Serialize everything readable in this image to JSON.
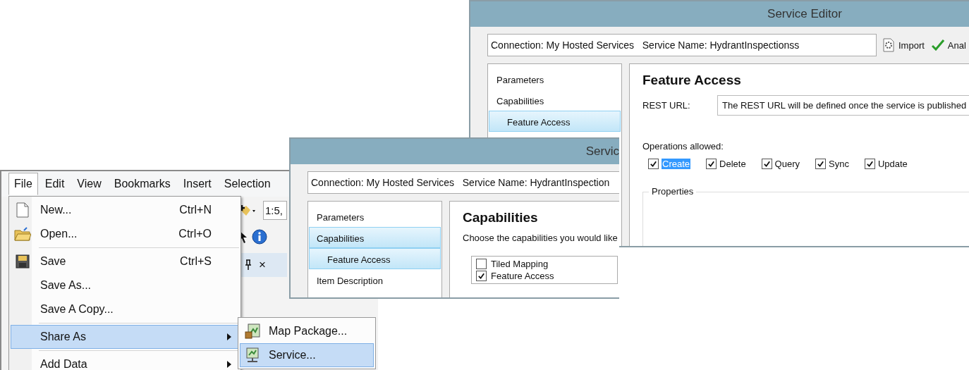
{
  "map_window": {
    "menu_bar": [
      {
        "label": "File",
        "selected": true
      },
      {
        "label": "Edit",
        "selected": false
      },
      {
        "label": "View",
        "selected": false
      },
      {
        "label": "Bookmarks",
        "selected": false
      },
      {
        "label": "Insert",
        "selected": false
      },
      {
        "label": "Selection",
        "selected": false
      }
    ],
    "toolbar": {
      "scale": "1:5,"
    },
    "panel": {
      "close": "×"
    },
    "file_menu": [
      [
        {
          "label": "New...",
          "shortcut": "Ctrl+N",
          "submenu": false,
          "selected": false
        },
        {
          "label": "Open...",
          "shortcut": "Ctrl+O",
          "submenu": false,
          "selected": false
        }
      ],
      [
        {
          "label": "Save",
          "shortcut": "Ctrl+S",
          "submenu": false,
          "selected": false
        },
        {
          "label": "Save As...",
          "submenu": false,
          "selected": false
        },
        {
          "label": "Save A Copy...",
          "submenu": false,
          "selected": false
        }
      ],
      [
        {
          "label": "Share As",
          "submenu": true,
          "selected": true
        }
      ],
      [
        {
          "label": "Add Data",
          "submenu": true,
          "selected": false
        }
      ]
    ],
    "share_submenu": [
      {
        "label": "Map Package...",
        "selected": false
      },
      {
        "label": "Service...",
        "selected": true
      }
    ]
  },
  "capabilities_window": {
    "title": "Servic",
    "info": "Connection: My Hosted Services   Service Name: HydrantInspection",
    "nav": [
      {
        "label": "Parameters",
        "selected": false
      },
      {
        "label": "Capabilities",
        "selected": true,
        "children": [
          {
            "label": "Feature Access",
            "selected": true
          }
        ]
      },
      {
        "label": "Item Description",
        "selected": false
      }
    ],
    "heading": "Capabilities",
    "prompt": "Choose the capabilities you would like",
    "capabilities": [
      {
        "label": "Tiled Mapping",
        "checked": false
      },
      {
        "label": "Feature Access",
        "checked": true
      }
    ]
  },
  "editor_window": {
    "title": "Service Editor",
    "info": "Connection: My Hosted Services   Service Name: HydrantInspectionss",
    "toolbar": [
      {
        "label": "Import"
      },
      {
        "label": "Anal"
      }
    ],
    "nav": [
      {
        "label": "Parameters",
        "selected": false
      },
      {
        "label": "Capabilities",
        "selected": false,
        "children": [
          {
            "label": "Feature Access",
            "selected": true
          }
        ]
      }
    ],
    "heading": "Feature Access",
    "rest_url": {
      "label": "REST URL:",
      "value": "The REST URL will be defined once the service is published"
    },
    "operations_label": "Operations allowed:",
    "operations": [
      {
        "label": "Create",
        "checked": true,
        "focused": true
      },
      {
        "label": "Delete",
        "checked": true,
        "focused": false
      },
      {
        "label": "Query",
        "checked": true,
        "focused": false
      },
      {
        "label": "Sync",
        "checked": true,
        "focused": false
      },
      {
        "label": "Update",
        "checked": true,
        "focused": false
      }
    ],
    "properties_label": "Properties"
  }
}
